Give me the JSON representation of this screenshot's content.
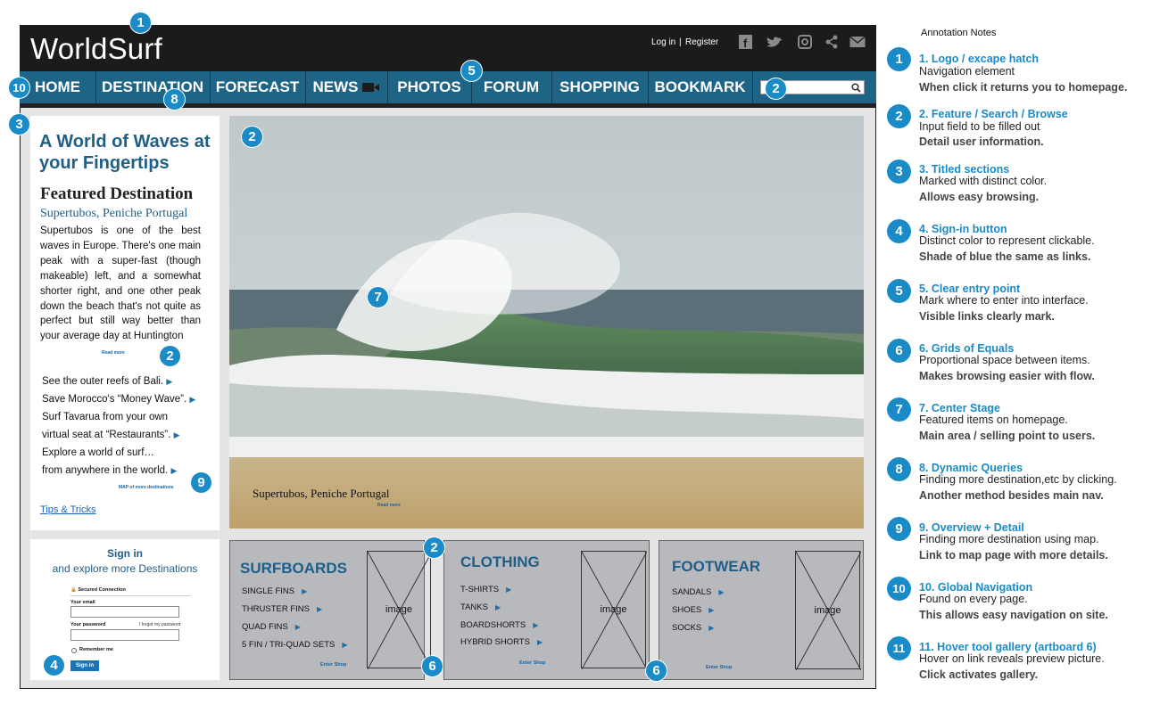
{
  "site": {
    "logo": "WorldSurf",
    "top_links": [
      "Log in",
      "|",
      "Register"
    ],
    "social_icons": [
      "facebook-icon",
      "twitter-icon",
      "instagram-icon",
      "share-icon",
      "mail-icon"
    ]
  },
  "nav": {
    "items": [
      "HOME",
      "DESTINATION",
      "FORECAST",
      "NEWS",
      "PHOTOS",
      "FORUM",
      "SHOPPING",
      "BOOKMARK"
    ]
  },
  "hero": {
    "title": "A World of Waves at your Fingertips",
    "featured_heading": "Featured Destination",
    "featured_sub": "Supertubos, Peniche Portugal",
    "body": "Supertubos is one of the best waves in Europe. There's one main peak with a super-fast (though makeable) left, and a somewhat shorter right, and one other peak down the beach that's not quite as perfect but still way better than your average day at Huntington",
    "read_more": "Read more",
    "stories": [
      "See the outer reefs of Bali.",
      "Save Morocco's “Money Wave”.",
      "Surf Tavarua from your own",
      "virtual seat at “Restaurants”.",
      "Explore a world of surf…",
      "from anywhere in the world."
    ],
    "map_link": "MAP of more destinations",
    "tips": "Tips & Tricks",
    "image_caption": "Supertubos, Peniche Portugal",
    "image_read_more": "Read more"
  },
  "signin": {
    "title": "Sign in",
    "subtitle": "and explore more Destinations",
    "secure": "Secured Connection",
    "email_label": "Your email",
    "password_label": "Your password",
    "forgot": "I forgot my password",
    "remember": "Remember me",
    "button": "Sign in"
  },
  "shops": [
    {
      "title": "SURFBOARDS",
      "items": [
        "SINGLE FINS",
        "THRUSTER FINS",
        "QUAD FINS",
        "5 FIN / TRI-QUAD SETS"
      ],
      "image": "image",
      "enter": "Enter Shop"
    },
    {
      "title": "CLOTHING",
      "items": [
        "T-SHIRTS",
        "TANKS",
        "BOARDSHORTS",
        "HYBRID SHORTS"
      ],
      "image": "image",
      "enter": "Enter Shop"
    },
    {
      "title": "FOOTWEAR",
      "items": [
        "SANDALS",
        "SHOES",
        "SOCKS"
      ],
      "image": "image",
      "enter": "Enter Shop"
    }
  ],
  "badges": [
    "1",
    "2",
    "3",
    "4",
    "5",
    "6",
    "7",
    "8",
    "9",
    "10",
    "11"
  ],
  "notes": {
    "title": "Annotation Notes",
    "items": [
      {
        "num": "1",
        "title": "1. Logo / excape hatch",
        "desc": "Navigation element",
        "bold": "When click it returns you to homepage."
      },
      {
        "num": "2",
        "title": "2. Feature / Search / Browse",
        "desc": "Input field to be filled out",
        "bold": "Detail user information."
      },
      {
        "num": "3",
        "title": "3. Titled sections",
        "desc": "Marked with distinct color.",
        "bold": "Allows easy browsing."
      },
      {
        "num": "4",
        "title": "4. Sign-in button",
        "desc": "Distinct color to represent clickable.",
        "bold": "Shade of blue the same as links."
      },
      {
        "num": "5",
        "title": "5. Clear entry point",
        "desc": "Mark where to enter into interface.",
        "bold": "Visible links clearly mark."
      },
      {
        "num": "6",
        "title": "6. Grids of Equals",
        "desc": "Proportional space between items.",
        "bold": "Makes browsing easier with flow."
      },
      {
        "num": "7",
        "title": "7. Center Stage",
        "desc": "Featured items on homepage.",
        "bold": "Main area / selling point to users."
      },
      {
        "num": "8",
        "title": "8. Dynamic Queries",
        "desc": "Finding more destination,etc by clicking.",
        "bold": "Another method besides main nav."
      },
      {
        "num": "9",
        "title": "9. Overview + Detail",
        "desc": "Finding more destination using map.",
        "bold": "Link to map page with more details."
      },
      {
        "num": "10",
        "title": "10. Global Navigation",
        "desc": "Found on every page.",
        "bold": "This allows easy navigation on site."
      },
      {
        "num": "11",
        "title": "11. Hover tool gallery (artboard 6)",
        "desc": "Hover on link reveals preview picture.",
        "bold": "Click activates gallery."
      }
    ]
  },
  "colors": {
    "nav_blue": "#1d6486",
    "accent_blue": "#1a8bc6",
    "heading_blue": "#1f5f86",
    "topbar": "#1b1b1b",
    "shop_gray": "#b8b9bd"
  }
}
